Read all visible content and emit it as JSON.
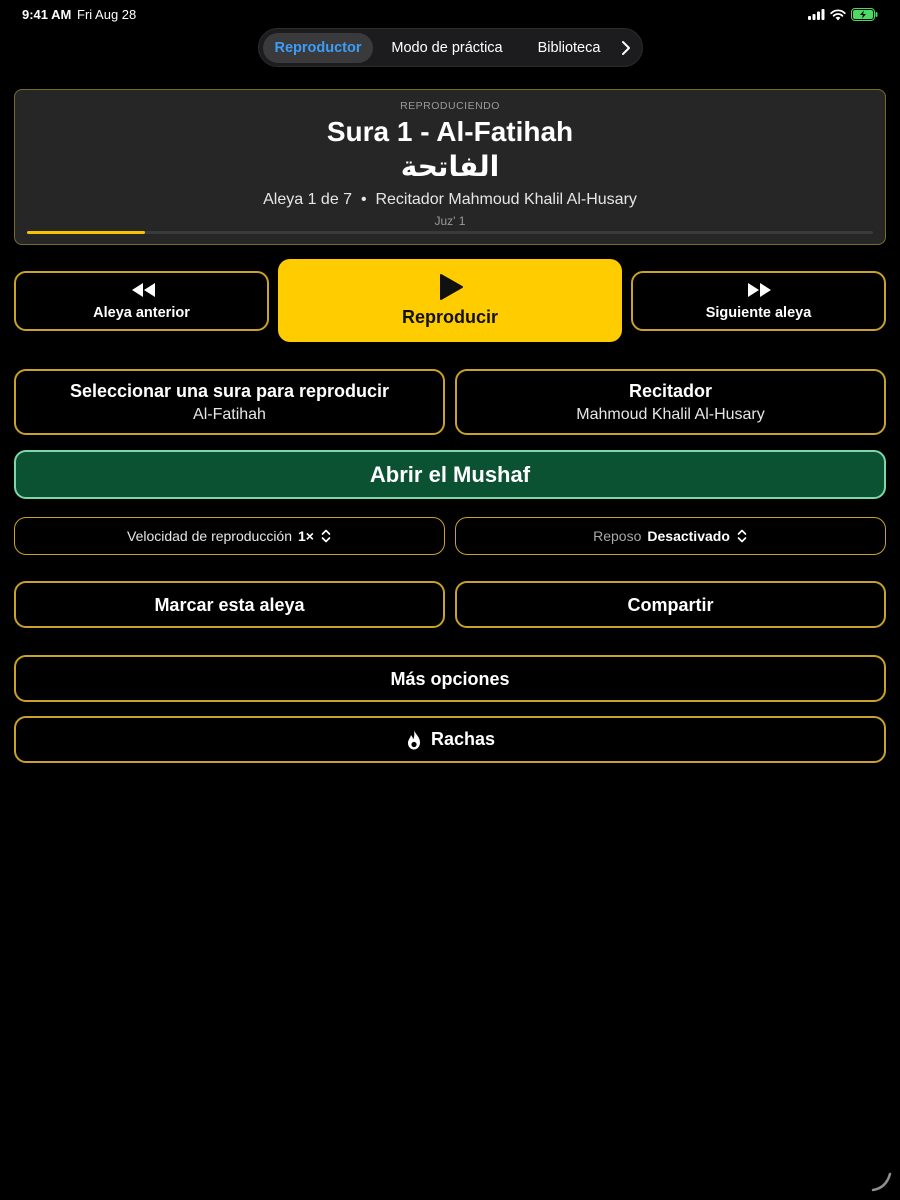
{
  "status": {
    "time": "9:41 AM",
    "date": "Fri Aug 28"
  },
  "nav": {
    "tabs": [
      {
        "label": "Reproductor",
        "active": true
      },
      {
        "label": "Modo de práctica",
        "active": false
      },
      {
        "label": "Biblioteca",
        "active": false
      }
    ]
  },
  "now_playing": {
    "eyebrow": "REPRODUCIENDO",
    "title": "Sura 1 - Al-Fatihah",
    "arabic": "الفاتحة",
    "meta": "Aleya 1 de 7  •  Recitador Mahmoud Khalil Al-Husary",
    "juz": "Juz' 1",
    "progress": 0.14
  },
  "controls": {
    "prev_label": "Aleya anterior",
    "play_label": "Reproducir",
    "next_label": "Siguiente aleya"
  },
  "sura_select": {
    "title": "Seleccionar una sura para reproducir",
    "value": "Al-Fatihah"
  },
  "reciter_select": {
    "title": "Recitador",
    "value": "Mahmoud Khalil Al-Husary"
  },
  "mushaf_label": "Abrir el Mushaf",
  "speed": {
    "label": "Velocidad de reproducción",
    "value": "1×"
  },
  "sleep": {
    "label": "Reposo",
    "value": "Desactivado"
  },
  "bookmark_label": "Marcar esta aleya",
  "share_label": "Compartir",
  "more_label": "Más opciones",
  "streaks_label": "Rachas",
  "colors": {
    "accent": "#ffcc00",
    "border": "#c9a227",
    "mushaf_bg": "#0b5233",
    "tab_active": "#3b9df7"
  }
}
